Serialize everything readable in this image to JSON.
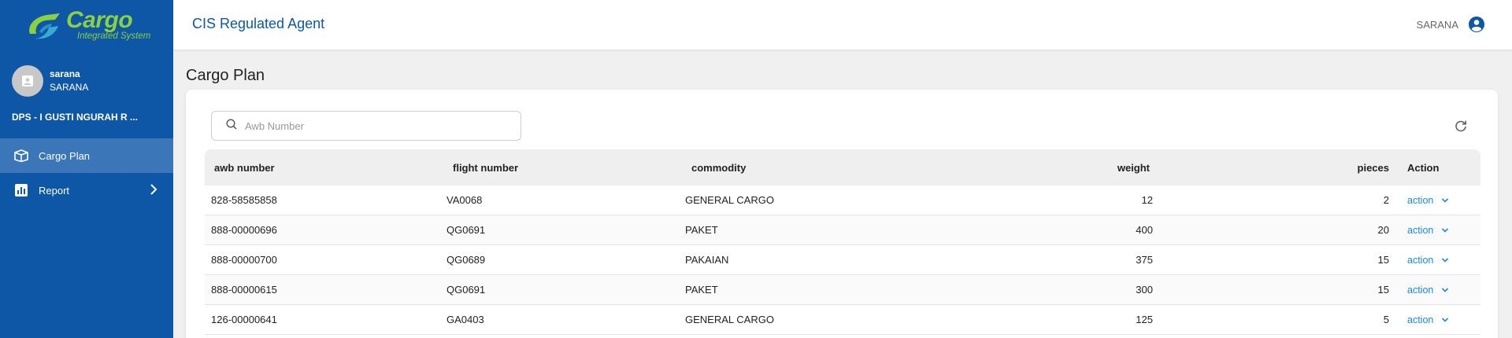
{
  "app": {
    "logo_title": "Cargo",
    "logo_subtitle": "Integrated System",
    "header_title": "CIS Regulated Agent",
    "header_user": "SARANA"
  },
  "sidebar": {
    "user_name": "sarana",
    "user_role": "SARANA",
    "station": "DPS - I GUSTI NGURAH R ...",
    "items": [
      {
        "label": "Cargo Plan",
        "icon": "box-icon",
        "active": true
      },
      {
        "label": "Report",
        "icon": "bar-chart-icon",
        "active": false
      }
    ]
  },
  "page": {
    "title": "Cargo Plan",
    "search_placeholder": "Awb Number"
  },
  "table": {
    "headers": {
      "awb": "awb number",
      "flight": "flight number",
      "commodity": "commodity",
      "weight": "weight",
      "pieces": "pieces",
      "action": "Action"
    },
    "rows": [
      {
        "awb": "828-58585858",
        "flight": "VA0068",
        "commodity": "GENERAL CARGO",
        "weight": "12",
        "pieces": "2",
        "action": "action"
      },
      {
        "awb": "888-00000696",
        "flight": "QG0691",
        "commodity": "PAKET",
        "weight": "400",
        "pieces": "20",
        "action": "action"
      },
      {
        "awb": "888-00000700",
        "flight": "QG0689",
        "commodity": "PAKAIAN",
        "weight": "375",
        "pieces": "15",
        "action": "action"
      },
      {
        "awb": "888-00000615",
        "flight": "QG0691",
        "commodity": "PAKET",
        "weight": "300",
        "pieces": "15",
        "action": "action"
      },
      {
        "awb": "126-00000641",
        "flight": "GA0403",
        "commodity": "GENERAL CARGO",
        "weight": "125",
        "pieces": "5",
        "action": "action"
      }
    ]
  },
  "colors": {
    "sidebar": "#0d57a6",
    "sidebar_active": "#3a76b8",
    "logo_accent": "#8bd03f",
    "link": "#1e88e5"
  }
}
